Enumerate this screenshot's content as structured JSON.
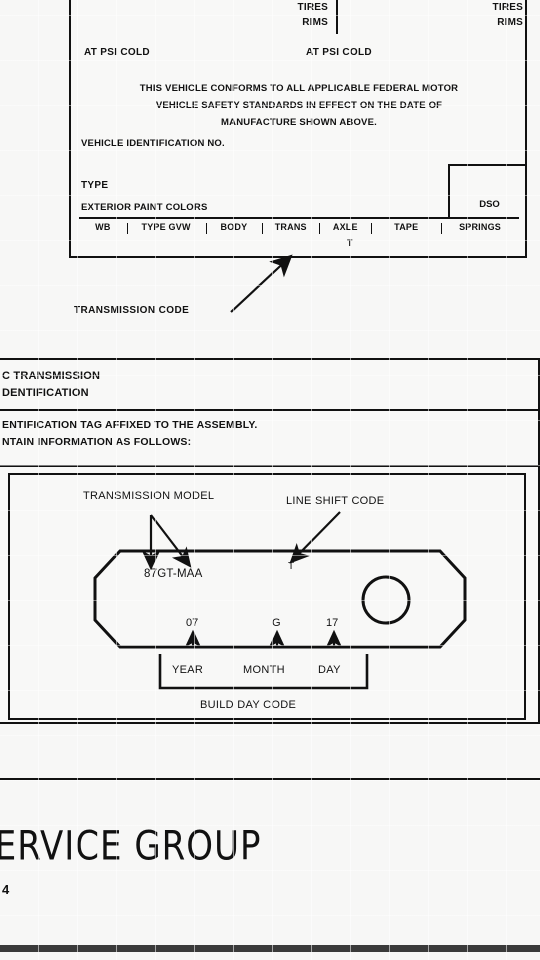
{
  "document": {
    "kind": "service-manual-page",
    "background_color": "#f7f7f6",
    "ink_color": "#111111"
  },
  "certification_label": {
    "tires_center": {
      "tires": "TIRES",
      "rims": "RIMS"
    },
    "tires_right": {
      "tires": "TIRES",
      "rims": "RIMS"
    },
    "psi_left": "AT   PSI COLD",
    "psi_right": "AT   PSI COLD",
    "conformance_line_1": "THIS VEHICLE CONFORMS TO ALL APPLICABLE FEDERAL MOTOR",
    "conformance_line_2": "VEHICLE SAFETY STANDARDS IN EFFECT ON THE DATE OF",
    "conformance_line_3": "MANUFACTURE SHOWN ABOVE.",
    "vin_label": "VEHICLE IDENTIFICATION NO.",
    "type_label": "TYPE",
    "paint_label": "EXTERIOR PAINT COLORS",
    "dso_label": "DSO",
    "code_columns": [
      "WB",
      "TYPE GVW",
      "BODY",
      "TRANS",
      "AXLE",
      "TAPE",
      "SPRINGS"
    ],
    "trans_value": "T",
    "callout_transmission_code": "TRANSMISSION CODE"
  },
  "transmission_section": {
    "title_line_1": "C TRANSMISSION",
    "title_line_2": "DENTIFICATION",
    "note_line_1": "ENTIFICATION TAG AFFIXED TO THE ASSEMBLY.",
    "note_line_2": "NTAIN INFORMATION AS FOLLOWS:",
    "diagram": {
      "callout_transmission_model": "TRANSMISSION MODEL",
      "callout_line_shift_code": "LINE SHIFT CODE",
      "model_value": "87GT-MAA",
      "line_shift_value": "T",
      "build_day_code": {
        "year_value": "07",
        "month_value": "G",
        "day_value": "17",
        "year_label": "YEAR",
        "month_label": "MONTH",
        "day_label": "DAY",
        "group_label": "BUILD DAY CODE"
      }
    }
  },
  "footer": {
    "title": "SSION SERVICE GROUP",
    "page_number": "4"
  }
}
